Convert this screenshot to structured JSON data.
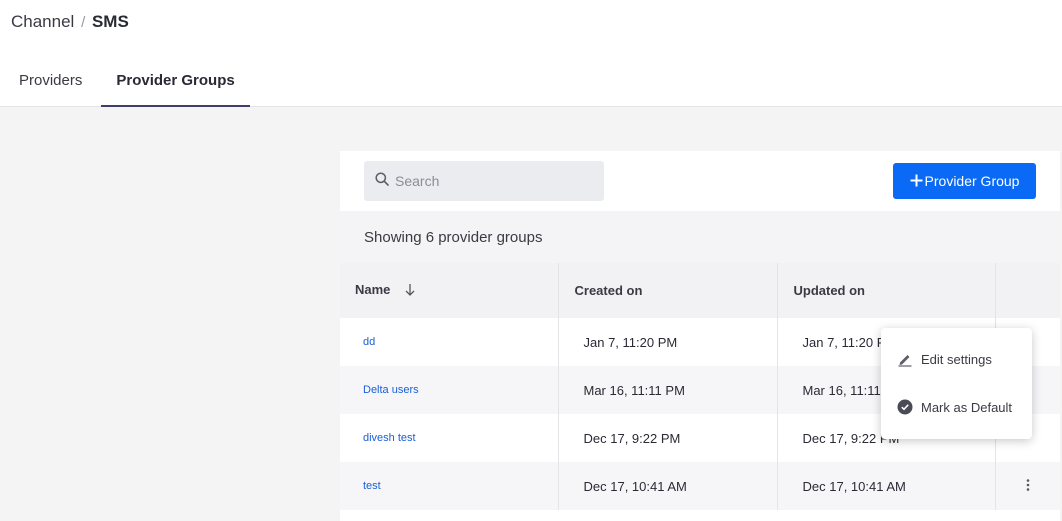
{
  "breadcrumb": {
    "parent": "Channel",
    "separator": "/",
    "current": "SMS"
  },
  "tabs": [
    {
      "label": "Providers",
      "active": false
    },
    {
      "label": "Provider Groups",
      "active": true
    }
  ],
  "search": {
    "placeholder": "Search",
    "value": ""
  },
  "add_button": {
    "label": "Provider Group"
  },
  "summary": "Showing 6 provider groups",
  "table": {
    "columns": [
      "Name",
      "Created on",
      "Updated on"
    ],
    "rows": [
      {
        "name": "dd",
        "created": "Jan 7, 11:20 PM",
        "updated": "Jan 7, 11:20 PM"
      },
      {
        "name": "Delta users",
        "created": "Mar 16, 11:11 PM",
        "updated": "Mar 16, 11:11 PM"
      },
      {
        "name": "divesh test",
        "created": "Dec 17, 9:22 PM",
        "updated": "Dec 17, 9:22 PM"
      },
      {
        "name": "test",
        "created": "Dec 17, 10:41 AM",
        "updated": "Dec 17, 10:41 AM"
      }
    ]
  },
  "context_menu": {
    "items": [
      {
        "label": "Edit settings",
        "icon": "pencil-icon"
      },
      {
        "label": "Mark as Default",
        "icon": "check-circle-icon"
      }
    ]
  },
  "colors": {
    "primary": "#0b6af5",
    "link": "#1a5fd6",
    "tab_underline": "#3f3f6a"
  }
}
